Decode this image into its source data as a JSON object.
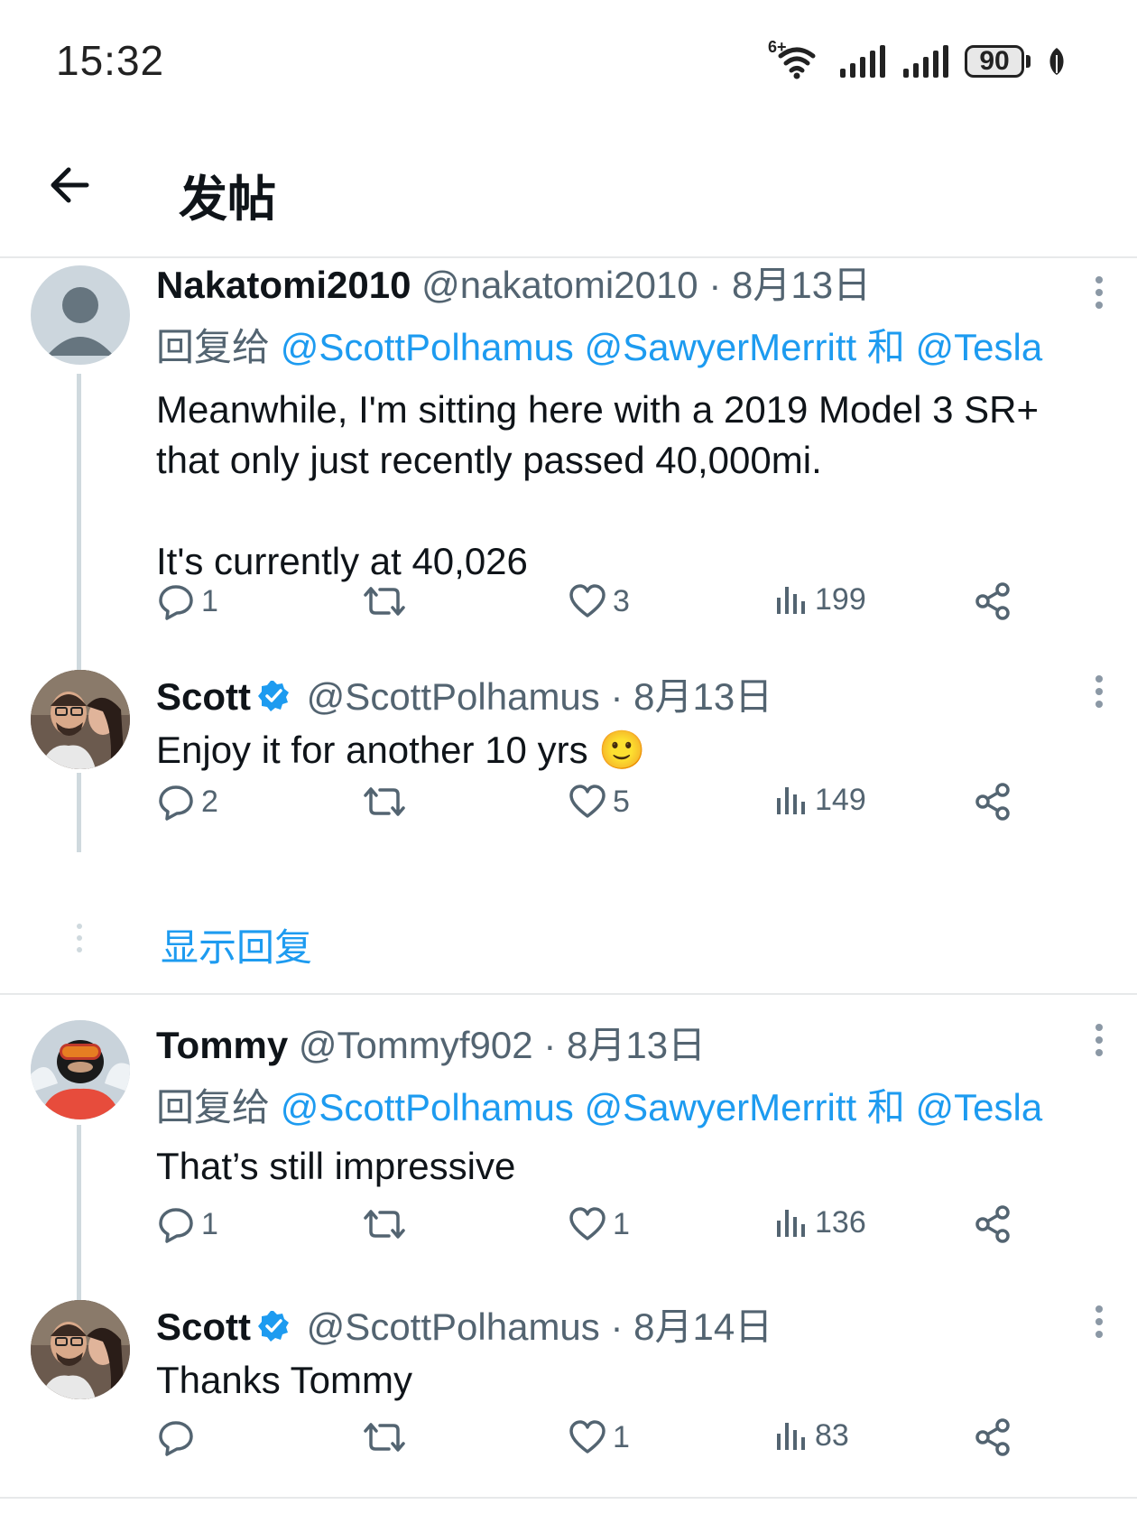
{
  "status_bar": {
    "time": "15:32",
    "battery": "90",
    "network_label": "6+"
  },
  "header": {
    "title": "发帖"
  },
  "tweets": [
    {
      "name": "Nakatomi2010",
      "handle": "@nakatomi2010",
      "date": "8月13日",
      "reply_prefix": "回复给",
      "mentions": [
        "@ScottPolhamus",
        "@SawyerMerritt",
        "@Tesla"
      ],
      "mention_joiner": "和",
      "body_lines": [
        "Meanwhile, I'm sitting here with a 2019 Model 3 SR+",
        "that only just recently passed 40,000mi.",
        "",
        "It's currently at 40,026"
      ],
      "replies": "1",
      "likes": "3",
      "views": "199"
    },
    {
      "name": "Scott",
      "handle": "@ScottPolhamus",
      "date": "8月13日",
      "body": "Enjoy it for another 10 yrs 🙂",
      "replies": "2",
      "likes": "5",
      "views": "149"
    },
    {
      "name": "Tommy",
      "handle": "@Tommyf902",
      "date": "8月13日",
      "reply_prefix": "回复给",
      "mentions": [
        "@ScottPolhamus",
        "@SawyerMerritt",
        "@Tesla"
      ],
      "mention_joiner": "和",
      "body": "That’s still impressive",
      "replies": "1",
      "likes": "1",
      "views": "136"
    },
    {
      "name": "Scott",
      "handle": "@ScottPolhamus",
      "date": "8月14日",
      "body": "Thanks Tommy",
      "replies": "",
      "likes": "1",
      "views": "83"
    }
  ],
  "show_replies": "显示回复",
  "separator": "·",
  "colors": {
    "accent": "#1d9bf0",
    "muted": "#536471",
    "text": "#0f1419"
  }
}
